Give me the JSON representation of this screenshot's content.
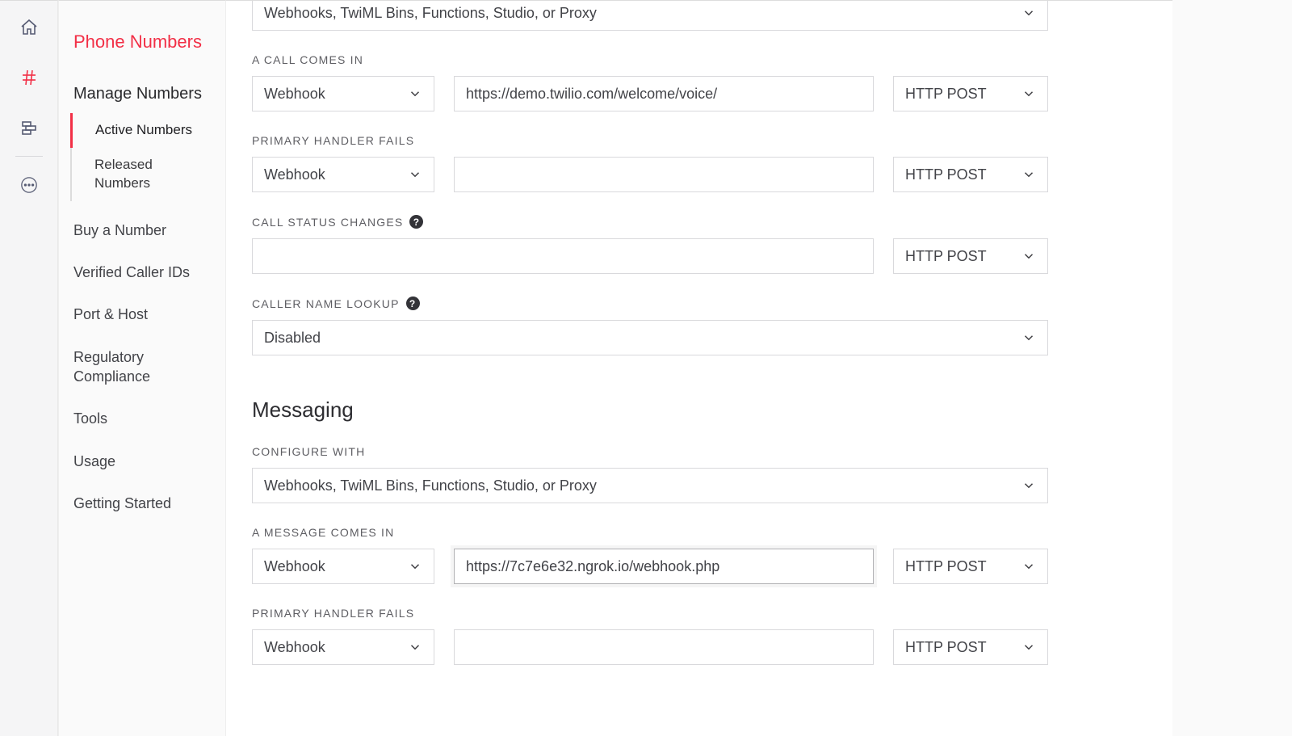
{
  "sidebar": {
    "section_title": "Phone Numbers",
    "group_title": "Manage Numbers",
    "subitems": [
      {
        "label": "Active Numbers",
        "active": true
      },
      {
        "label": "Released Numbers",
        "active": false
      }
    ],
    "navitems": [
      "Buy a Number",
      "Verified Caller IDs",
      "Port & Host",
      "Regulatory Compliance",
      "Tools",
      "Usage",
      "Getting Started"
    ]
  },
  "voice": {
    "configure_with": "Webhooks, TwiML Bins, Functions, Studio, or Proxy",
    "call_comes_in_label": "A CALL COMES IN",
    "call_comes_in_handler": "Webhook",
    "call_comes_in_url": "https://demo.twilio.com/welcome/voice/",
    "call_comes_in_method": "HTTP POST",
    "primary_fails_label": "PRIMARY HANDLER FAILS",
    "primary_fails_handler": "Webhook",
    "primary_fails_url": "",
    "primary_fails_method": "HTTP POST",
    "call_status_label": "CALL STATUS CHANGES",
    "call_status_url": "",
    "call_status_method": "HTTP POST",
    "caller_lookup_label": "CALLER NAME LOOKUP",
    "caller_lookup_value": "Disabled"
  },
  "messaging": {
    "section_title": "Messaging",
    "configure_label": "CONFIGURE WITH",
    "configure_with": "Webhooks, TwiML Bins, Functions, Studio, or Proxy",
    "message_comes_in_label": "A MESSAGE COMES IN",
    "message_comes_in_handler": "Webhook",
    "message_comes_in_url": "https://7c7e6e32.ngrok.io/webhook.php",
    "message_comes_in_method": "HTTP POST",
    "primary_fails_label": "PRIMARY HANDLER FAILS",
    "primary_fails_handler": "Webhook",
    "primary_fails_url": "",
    "primary_fails_method": "HTTP POST"
  },
  "glyphs": {
    "help": "?"
  }
}
